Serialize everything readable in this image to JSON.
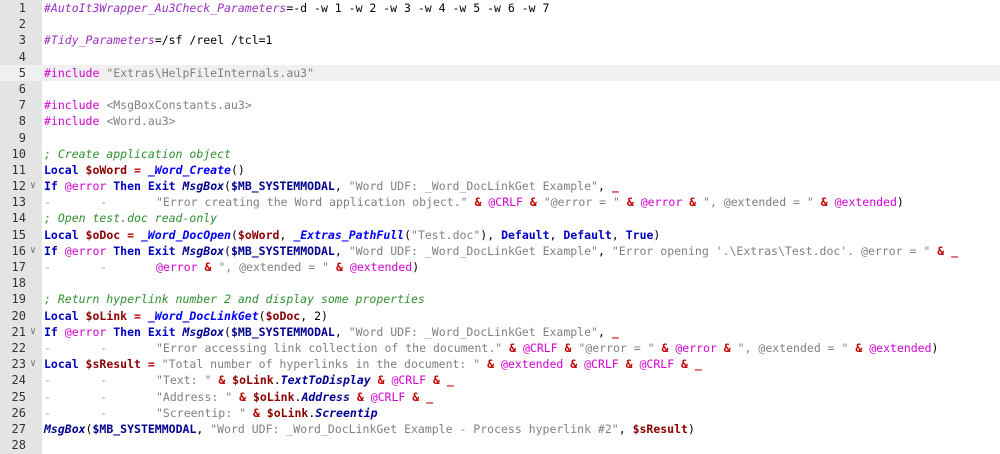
{
  "editor": {
    "current_line": 5,
    "lines": [
      {
        "n": "1",
        "fold": "",
        "tokens": [
          [
            "dir",
            "#AutoIt3Wrapper_Au3Check_Parameters"
          ],
          [
            "val",
            "=-d -w 1 -w 2 -w 3 -w 4 -w 5 -w 6 -w 7"
          ]
        ]
      },
      {
        "n": "2",
        "fold": "",
        "tokens": []
      },
      {
        "n": "3",
        "fold": "",
        "tokens": [
          [
            "dir",
            "#Tidy_Parameters"
          ],
          [
            "val",
            "=/sf /reel /tcl=1"
          ]
        ]
      },
      {
        "n": "4",
        "fold": "",
        "tokens": []
      },
      {
        "n": "5",
        "fold": "",
        "tokens": [
          [
            "inc",
            "#include "
          ],
          [
            "incf",
            "\"Extras\\HelpFileInternals.au3\""
          ]
        ]
      },
      {
        "n": "6",
        "fold": "",
        "tokens": []
      },
      {
        "n": "7",
        "fold": "",
        "tokens": [
          [
            "inc",
            "#include "
          ],
          [
            "incf",
            "<MsgBoxConstants.au3>"
          ]
        ]
      },
      {
        "n": "8",
        "fold": "",
        "tokens": [
          [
            "inc",
            "#include "
          ],
          [
            "incf",
            "<Word.au3>"
          ]
        ]
      },
      {
        "n": "9",
        "fold": "",
        "tokens": []
      },
      {
        "n": "10",
        "fold": "",
        "tokens": [
          [
            "com",
            "; Create application object"
          ]
        ]
      },
      {
        "n": "11",
        "fold": "",
        "tokens": [
          [
            "key",
            "Local "
          ],
          [
            "var",
            "$oWord"
          ],
          [
            "op",
            " = "
          ],
          [
            "udf",
            "_Word_Create"
          ],
          [
            "txt",
            "()"
          ]
        ]
      },
      {
        "n": "12",
        "fold": "∨",
        "tokens": [
          [
            "key",
            "If "
          ],
          [
            "mac",
            "@error "
          ],
          [
            "key",
            "Then Exit "
          ],
          [
            "fn",
            "MsgBox"
          ],
          [
            "txt",
            "("
          ],
          [
            "cst",
            "$MB_SYSTEMMODAL"
          ],
          [
            "txt",
            ", "
          ],
          [
            "str",
            "\"Word UDF: _Word_DocLinkGet Example\""
          ],
          [
            "txt",
            ", "
          ],
          [
            "op",
            "_"
          ]
        ]
      },
      {
        "n": "13",
        "fold": "",
        "tokens": [
          [
            "tab",
            "-"
          ],
          [
            "tab",
            "-"
          ],
          [
            "str",
            "\"Error creating the Word application object.\""
          ],
          [
            "op",
            " & "
          ],
          [
            "mac",
            "@CRLF"
          ],
          [
            "op",
            " & "
          ],
          [
            "str",
            "\"@error = \""
          ],
          [
            "op",
            " & "
          ],
          [
            "mac",
            "@error"
          ],
          [
            "op",
            " & "
          ],
          [
            "str",
            "\", @extended = \""
          ],
          [
            "op",
            " & "
          ],
          [
            "mac",
            "@extended"
          ],
          [
            "txt",
            ")"
          ]
        ]
      },
      {
        "n": "14",
        "fold": "",
        "tokens": [
          [
            "com",
            "; Open test.doc read-only"
          ]
        ]
      },
      {
        "n": "15",
        "fold": "",
        "tokens": [
          [
            "key",
            "Local "
          ],
          [
            "var",
            "$oDoc"
          ],
          [
            "op",
            " = "
          ],
          [
            "udf",
            "_Word_DocOpen"
          ],
          [
            "txt",
            "("
          ],
          [
            "var",
            "$oWord"
          ],
          [
            "txt",
            ", "
          ],
          [
            "udf",
            "_Extras_PathFull"
          ],
          [
            "txt",
            "("
          ],
          [
            "str",
            "\"Test.doc\""
          ],
          [
            "txt",
            "), "
          ],
          [
            "key",
            "Default"
          ],
          [
            "txt",
            ", "
          ],
          [
            "key",
            "Default"
          ],
          [
            "txt",
            ", "
          ],
          [
            "key",
            "True"
          ],
          [
            "txt",
            ")"
          ]
        ]
      },
      {
        "n": "16",
        "fold": "∨",
        "tokens": [
          [
            "key",
            "If "
          ],
          [
            "mac",
            "@error "
          ],
          [
            "key",
            "Then Exit "
          ],
          [
            "fn",
            "MsgBox"
          ],
          [
            "txt",
            "("
          ],
          [
            "cst",
            "$MB_SYSTEMMODAL"
          ],
          [
            "txt",
            ", "
          ],
          [
            "str",
            "\"Word UDF: _Word_DocLinkGet Example\""
          ],
          [
            "txt",
            ", "
          ],
          [
            "str",
            "\"Error opening '.\\Extras\\Test.doc'. @error = \""
          ],
          [
            "op",
            " & _"
          ]
        ]
      },
      {
        "n": "17",
        "fold": "",
        "tokens": [
          [
            "tab",
            "-"
          ],
          [
            "tab",
            "-"
          ],
          [
            "mac",
            "@error"
          ],
          [
            "op",
            " & "
          ],
          [
            "str",
            "\", @extended = \""
          ],
          [
            "op",
            " & "
          ],
          [
            "mac",
            "@extended"
          ],
          [
            "txt",
            ")"
          ]
        ]
      },
      {
        "n": "18",
        "fold": "",
        "tokens": []
      },
      {
        "n": "19",
        "fold": "",
        "tokens": [
          [
            "com",
            "; Return hyperlink number 2 and display some properties"
          ]
        ]
      },
      {
        "n": "20",
        "fold": "",
        "tokens": [
          [
            "key",
            "Local "
          ],
          [
            "var",
            "$oLink"
          ],
          [
            "op",
            " = "
          ],
          [
            "udf",
            "_Word_DocLinkGet"
          ],
          [
            "txt",
            "("
          ],
          [
            "var",
            "$oDoc"
          ],
          [
            "txt",
            ", "
          ],
          [
            "num",
            "2"
          ],
          [
            "txt",
            ")"
          ]
        ]
      },
      {
        "n": "21",
        "fold": "∨",
        "tokens": [
          [
            "key",
            "If "
          ],
          [
            "mac",
            "@error "
          ],
          [
            "key",
            "Then Exit "
          ],
          [
            "fn",
            "MsgBox"
          ],
          [
            "txt",
            "("
          ],
          [
            "cst",
            "$MB_SYSTEMMODAL"
          ],
          [
            "txt",
            ", "
          ],
          [
            "str",
            "\"Word UDF: _Word_DocLinkGet Example\""
          ],
          [
            "txt",
            ", "
          ],
          [
            "op",
            "_"
          ]
        ]
      },
      {
        "n": "22",
        "fold": "",
        "tokens": [
          [
            "tab",
            "-"
          ],
          [
            "tab",
            "-"
          ],
          [
            "str",
            "\"Error accessing link collection of the document.\""
          ],
          [
            "op",
            " & "
          ],
          [
            "mac",
            "@CRLF"
          ],
          [
            "op",
            " & "
          ],
          [
            "str",
            "\"@error = \""
          ],
          [
            "op",
            " & "
          ],
          [
            "mac",
            "@error"
          ],
          [
            "op",
            " & "
          ],
          [
            "str",
            "\", @extended = \""
          ],
          [
            "op",
            " & "
          ],
          [
            "mac",
            "@extended"
          ],
          [
            "txt",
            ")"
          ]
        ]
      },
      {
        "n": "23",
        "fold": "∨",
        "tokens": [
          [
            "key",
            "Local "
          ],
          [
            "var",
            "$sResult"
          ],
          [
            "op",
            " = "
          ],
          [
            "str",
            "\"Total number of hyperlinks in the document: \""
          ],
          [
            "op",
            " & "
          ],
          [
            "mac",
            "@extended"
          ],
          [
            "op",
            " & "
          ],
          [
            "mac",
            "@CRLF"
          ],
          [
            "op",
            " & "
          ],
          [
            "mac",
            "@CRLF"
          ],
          [
            "op",
            " & _"
          ]
        ]
      },
      {
        "n": "24",
        "fold": "",
        "tokens": [
          [
            "tab",
            "-"
          ],
          [
            "tab",
            "-"
          ],
          [
            "str",
            "\"Text: \""
          ],
          [
            "op",
            " & "
          ],
          [
            "var",
            "$oLink"
          ],
          [
            "txt",
            "."
          ],
          [
            "fn",
            "TextToDisplay"
          ],
          [
            "op",
            " & "
          ],
          [
            "mac",
            "@CRLF"
          ],
          [
            "op",
            " & _"
          ]
        ]
      },
      {
        "n": "25",
        "fold": "",
        "tokens": [
          [
            "tab",
            "-"
          ],
          [
            "tab",
            "-"
          ],
          [
            "str",
            "\"Address: \""
          ],
          [
            "op",
            " & "
          ],
          [
            "var",
            "$oLink"
          ],
          [
            "txt",
            "."
          ],
          [
            "fn",
            "Address"
          ],
          [
            "op",
            " & "
          ],
          [
            "mac",
            "@CRLF"
          ],
          [
            "op",
            " & _"
          ]
        ]
      },
      {
        "n": "26",
        "fold": "",
        "tokens": [
          [
            "tab",
            "-"
          ],
          [
            "tab",
            "-"
          ],
          [
            "str",
            "\"Screentip: \""
          ],
          [
            "op",
            " & "
          ],
          [
            "var",
            "$oLink"
          ],
          [
            "txt",
            "."
          ],
          [
            "fn",
            "Screentip"
          ]
        ]
      },
      {
        "n": "27",
        "fold": "",
        "tokens": [
          [
            "fn",
            "MsgBox"
          ],
          [
            "txt",
            "("
          ],
          [
            "cst",
            "$MB_SYSTEMMODAL"
          ],
          [
            "txt",
            ", "
          ],
          [
            "str",
            "\"Word UDF: _Word_DocLinkGet Example - Process hyperlink #2\""
          ],
          [
            "txt",
            ", "
          ],
          [
            "var",
            "$sResult"
          ],
          [
            "txt",
            ")"
          ]
        ]
      },
      {
        "n": "28",
        "fold": "",
        "tokens": []
      }
    ]
  }
}
